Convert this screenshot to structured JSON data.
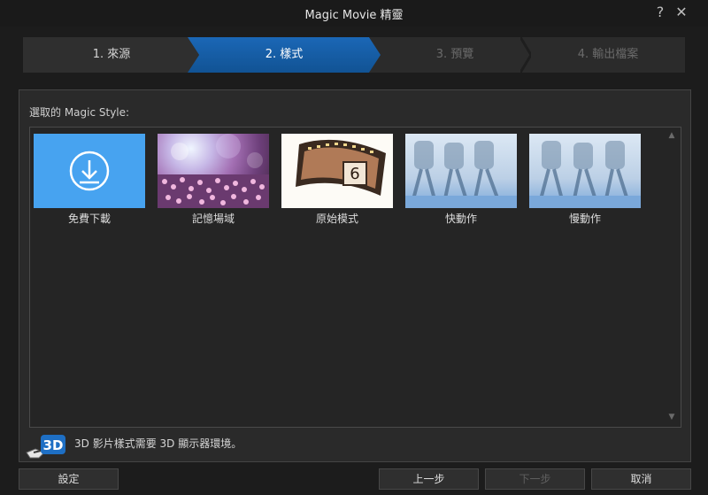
{
  "window": {
    "title": "Magic Movie 精靈",
    "help_label": "?",
    "close_label": "✕"
  },
  "steps": [
    {
      "label": "1. 來源",
      "state": "completed"
    },
    {
      "label": "2. 樣式",
      "state": "active"
    },
    {
      "label": "3. 預覽",
      "state": "disabled"
    },
    {
      "label": "4. 輸出檔案",
      "state": "disabled"
    }
  ],
  "section": {
    "label": "選取的 Magic Style:"
  },
  "styles": [
    {
      "label": "免費下載",
      "icon": "download-icon"
    },
    {
      "label": "記憶場域",
      "icon": "memory-thumbnail"
    },
    {
      "label": "原始模式",
      "icon": "film-strip-thumbnail"
    },
    {
      "label": "快動作",
      "icon": "runner-thumbnail"
    },
    {
      "label": "慢動作",
      "icon": "runner-thumbnail"
    }
  ],
  "note": {
    "icon": "3d-glasses-icon",
    "badge_text": "3D",
    "text": "3D 影片樣式需要 3D 顯示器環境。"
  },
  "buttons": {
    "settings": "設定",
    "back": "上一步",
    "next": "下一步",
    "cancel": "取消"
  },
  "colors": {
    "accent": "#1b67b6",
    "download_tile": "#47a3f0"
  }
}
